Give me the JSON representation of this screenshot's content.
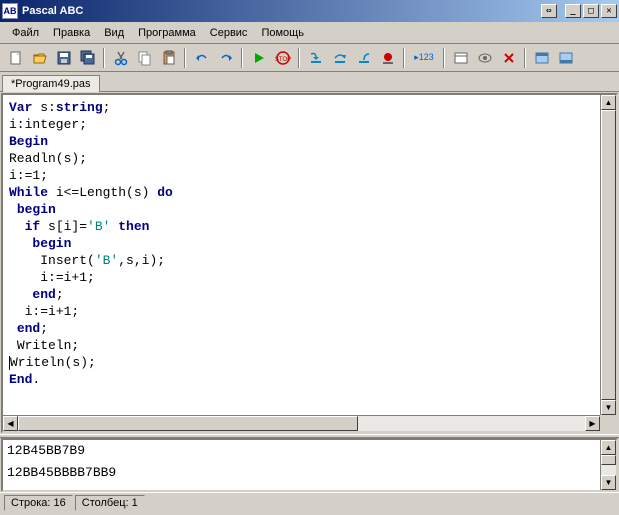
{
  "window": {
    "title": "Pascal ABC"
  },
  "menu": [
    "Файл",
    "Правка",
    "Вид",
    "Программа",
    "Сервис",
    "Помощь"
  ],
  "tab": "*Program49.pas",
  "code": {
    "l1a": "Var",
    "l1b": " s:",
    "l1c": "string",
    "l1d": ";",
    "l2": "i:integer;",
    "l3": "Begin",
    "l4": "Readln(s);",
    "l5": "i:=1;",
    "l6a": "While",
    "l6b": " i<=Length(s) ",
    "l6c": "do",
    "l7": "begin",
    "l8a": "if",
    "l8b": " s[i]=",
    "l8c": "'В'",
    "l8d": " ",
    "l8e": "then",
    "l9": "begin",
    "l10a": "Insert(",
    "l10b": "'В'",
    "l10c": ",s,i);",
    "l11": "i:=i+1;",
    "l12": "end",
    "l12b": ";",
    "l13": "i:=i+1;",
    "l14": "end",
    "l14b": ";",
    "l15": "Writeln;",
    "l16": "Writeln(s);",
    "l17": "End",
    "l17b": "."
  },
  "output": {
    "line1": "12В45ВВ7В9",
    "line2": "12ВВ45ВВВВ7ВВ9"
  },
  "status": {
    "line": "Строка: 16",
    "col": "Столбец: 1"
  }
}
